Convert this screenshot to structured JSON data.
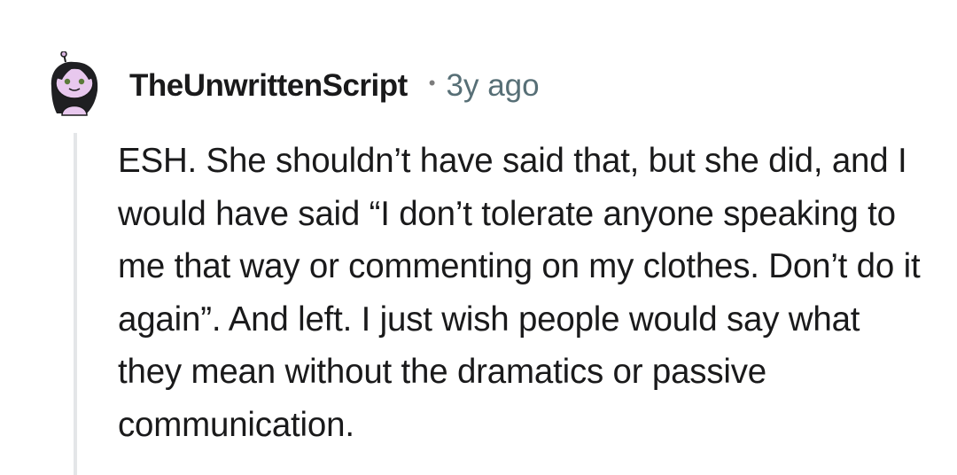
{
  "comment": {
    "author": "TheUnwrittenScript",
    "separator": "•",
    "age": "3y ago",
    "body": "ESH. She shouldn’t have said that, but she did, and I would have said “I don’t tolerate anyone speaking to me that way or commenting on my clothes. Don’t do it again”. And left. I just wish people would say what they mean without the dramatics or passive communication.",
    "avatar_icon": "snoo-avatar-icon"
  },
  "colors": {
    "background": "#ffffff",
    "text": "#1a1a1b",
    "meta": "#576f76",
    "thread_line": "#e4e6e8",
    "avatar_pink": "#e8c8ee"
  }
}
